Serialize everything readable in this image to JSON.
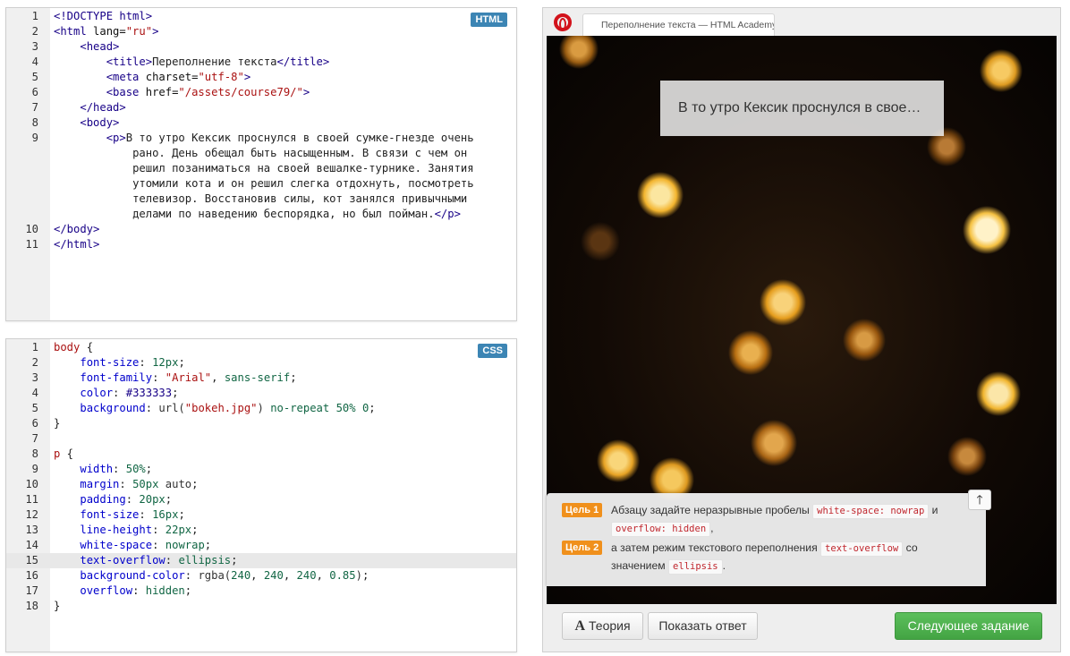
{
  "html_editor": {
    "badge": "HTML",
    "lines": [
      {
        "no": "1"
      },
      {
        "no": "2"
      },
      {
        "no": "3"
      },
      {
        "no": "4"
      },
      {
        "no": "5"
      },
      {
        "no": "6"
      },
      {
        "no": "7"
      },
      {
        "no": "8"
      },
      {
        "no": "9"
      },
      {
        "no": "10"
      },
      {
        "no": "11"
      }
    ],
    "code": {
      "doctype": "<!DOCTYPE html>",
      "html_open": "<html",
      "lang_attr": " lang=",
      "lang_val": "\"ru\"",
      "gt": ">",
      "head_open": "<head>",
      "title_open": "<title>",
      "title_text": "Переполнение текста",
      "title_close": "</title>",
      "meta_open": "<meta",
      "charset_attr": " charset=",
      "charset_val": "\"utf-8\"",
      "base_open": "<base",
      "href_attr": " href=",
      "href_val": "\"/assets/course79/\"",
      "head_close": "</head>",
      "body_open": "<body>",
      "p_open": "<p>",
      "p_text_1": "В то утро Кексик проснулся в своей сумке-гнезде очень",
      "p_text_2": "рано. День обещал быть насыщенным. В связи с чем он",
      "p_text_3": "решил позаниматься на своей вешалке-турнике. Занятия",
      "p_text_4": "утомили кота и он решил слегка отдохнуть, посмотреть",
      "p_text_5": "телевизор. Восстановив силы, кот занялся привычными",
      "p_text_6": "делами по наведению беспорядка, но был пойман.",
      "p_close": "</p>",
      "body_close": "</body>",
      "html_close": "</html>"
    }
  },
  "css_editor": {
    "badge": "CSS",
    "lines": [
      {
        "no": "1"
      },
      {
        "no": "2"
      },
      {
        "no": "3"
      },
      {
        "no": "4"
      },
      {
        "no": "5"
      },
      {
        "no": "6"
      },
      {
        "no": "7"
      },
      {
        "no": "8"
      },
      {
        "no": "9"
      },
      {
        "no": "10"
      },
      {
        "no": "11"
      },
      {
        "no": "12"
      },
      {
        "no": "13"
      },
      {
        "no": "14"
      },
      {
        "no": "15"
      },
      {
        "no": "16"
      },
      {
        "no": "17"
      },
      {
        "no": "18"
      }
    ],
    "active_line": "15",
    "code": {
      "sel_body": "body",
      "brace_open": " {",
      "brace_close": "}",
      "sel_p": "p",
      "colon": ":",
      "semi": ";",
      "comma": ",",
      "font_size": "font-size",
      "v_12px": "12px",
      "font_family": "font-family",
      "v_arial": "\"Arial\"",
      "v_sans": "sans-serif",
      "color": "color",
      "v_color": "#333333",
      "background": "background",
      "v_url": "url(",
      "v_bokeh": "\"bokeh.jpg\"",
      "v_url_close": ")",
      "v_norepeat": "no-repeat",
      "v_50pct": "50%",
      "v_0": "0",
      "width": "width",
      "margin": "margin",
      "v_50px": "50px",
      "v_auto": "auto",
      "padding": "padding",
      "v_20px": "20px",
      "v_16px": "16px",
      "line_height": "line-height",
      "v_22px": "22px",
      "white_space": "white-space",
      "v_nowrap": "nowrap",
      "text_overflow": "text-overflow",
      "v_ellipsis": "ellipsis",
      "bg_color": "background-color",
      "v_rgba": "rgba(",
      "v_240": "240",
      "v_085": "0.85",
      "v_rgba_close": ")",
      "overflow": "overflow",
      "v_hidden": "hidden"
    }
  },
  "preview": {
    "tab_title": "Переполнение текста — HTML Academy",
    "demo_paragraph": "В то утро Кексик проснулся в своей сумке-гнезде очень рано. День обещал быть насыщенным. В связи с чем он решил позаниматься на своей вешалке-турнике. Занятия утомили кота и он решил слегка отдохнуть, посмотреть телевизор. Восстановив силы, кот занялся привычными делами по наведению беспорядка, но был пойман."
  },
  "tasks": {
    "collapse_icon": "arrow-up-icon",
    "collapse_glyph": "🡑",
    "items": [
      {
        "label": "Цель 1",
        "text_before": "Абзацу задайте неразрывные пробелы ",
        "code_1": "white-space: nowrap",
        "text_mid": " и ",
        "code_2": "overflow: hidden",
        "text_after": ","
      },
      {
        "label": "Цель 2",
        "text_before": "а затем режим текстового переполнения ",
        "code_1": "text-overflow",
        "text_mid": " со значением ",
        "code_2": "ellipsis",
        "text_after": "."
      }
    ]
  },
  "buttons": {
    "theory_icon": "A",
    "theory_label": "Теория",
    "answer_label": "Показать ответ",
    "next_label": "Следующее задание"
  },
  "colors": {
    "badge_blue": "#3c85b4",
    "task_orange": "#f0901c",
    "next_green": "#4cae4c",
    "opera_red": "#d2121b"
  }
}
